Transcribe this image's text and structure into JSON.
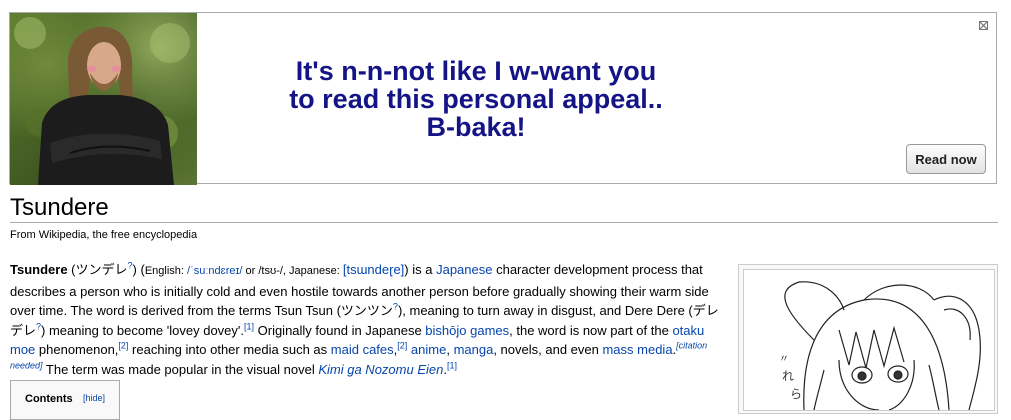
{
  "banner": {
    "appeal_lines": [
      "It's n-n-not like I w-want you",
      "to read this personal appeal..",
      "B-baka!"
    ],
    "read_button": "Read now"
  },
  "article": {
    "title": "Tsundere",
    "tagline": "From Wikipedia, the free encyclopedia",
    "t_bold": "Tsundere",
    "t_jp": " (ツンデレ",
    "t_q1": "?",
    "t_open": ") (",
    "t_english": "English: ",
    "t_ipa1": "/ˈsuːndɛreɪ/",
    "t_or": " or /tsʊ-/, ",
    "t_japanese": "Japanese: ",
    "t_ipa2": "[tsɯndeɽe]",
    "t_isa": ") is a ",
    "t_link_japanese": "Japanese",
    "t_2": " character development process that describes a person who is initially cold and even hostile towards another person before gradually showing their warm side over time. The word is derived from the terms Tsun Tsun (ツンツン",
    "t_q2": "?",
    "t_3": "), meaning to turn away in disgust, and Dere Dere (デレデレ",
    "t_q3": "?",
    "t_4": ") meaning to become 'lovey dovey'.",
    "t_ref1": "[1]",
    "t_5": " Originally found in Japanese ",
    "t_link_bishojo": "bishōjo games",
    "t_6": ", the word is now part of the ",
    "t_link_otaku": "otaku",
    "t_sp": " ",
    "t_link_moe": "moe",
    "t_7": " phenomenon,",
    "t_ref2": "[2]",
    "t_8": " reaching into other media such as ",
    "t_link_maid": "maid cafes",
    "t_9": ",",
    "t_ref2b": "[2]",
    "t_sp2": " ",
    "t_link_anime": "anime",
    "t_10": ", ",
    "t_link_manga": "manga",
    "t_11": ", novels, and even ",
    "t_link_mass": "mass media",
    "t_12": ".",
    "t_citation": "[citation needed]",
    "t_13": " The term was made popular in the visual novel ",
    "t_link_kimi": "Kimi ga Nozomu Eien",
    "t_14": ".",
    "t_ref1b": "[1]"
  },
  "toc": {
    "title": "Contents",
    "hide": "[hide]"
  },
  "colors": {
    "appeal": "#141487",
    "link": "#0645ad"
  }
}
